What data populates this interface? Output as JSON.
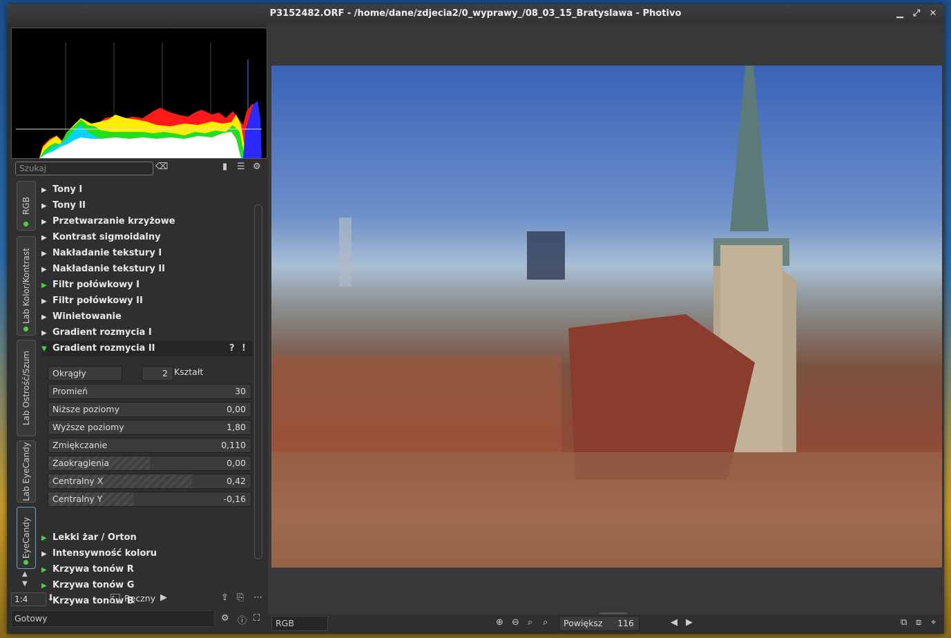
{
  "window": {
    "title": "P3152482.ORF - /home/dane/zdjecia2/0_wyprawy_/08_03_15_Bratyslawa - Photivo"
  },
  "search": {
    "placeholder": "Szukaj"
  },
  "tabs": [
    {
      "label": "RGB"
    },
    {
      "label": "Lab Kolor/Kontrast"
    },
    {
      "label": "Lab Ostrość/Szum"
    },
    {
      "label": "Lab EyeCandy"
    },
    {
      "label": "EyeCandy"
    }
  ],
  "tree": {
    "items_before": [
      {
        "label": "Tony I",
        "active": false
      },
      {
        "label": "Tony II",
        "active": false
      },
      {
        "label": "Przetwarzanie krzyżowe",
        "active": false
      },
      {
        "label": "Kontrast sigmoidalny",
        "active": false
      },
      {
        "label": "Nakładanie tekstury I",
        "active": false
      },
      {
        "label": "Nakładanie tekstury II",
        "active": false
      },
      {
        "label": "Filtr połówkowy I",
        "active": true
      },
      {
        "label": "Filtr połówkowy II",
        "active": false
      },
      {
        "label": "Winietowanie",
        "active": false
      },
      {
        "label": "Gradient rozmycia I",
        "active": false
      }
    ],
    "open_item": {
      "label": "Gradient rozmycia II"
    },
    "controls": {
      "mode": "Okrągły",
      "shape_value": "2",
      "shape_label": "Kształt",
      "sliders": [
        {
          "name": "Promień",
          "value": "30",
          "fill": 0
        },
        {
          "name": "Niższe poziomy",
          "value": "0,00",
          "fill": 0
        },
        {
          "name": "Wyższe poziomy",
          "value": "1,80",
          "fill": 0
        },
        {
          "name": "Zmiękczanie",
          "value": "0,110",
          "fill": 0
        },
        {
          "name": "Zaokrąglenia",
          "value": "0,00",
          "fill": 0.5
        },
        {
          "name": "Centralny X",
          "value": "0,42",
          "fill": 0.71
        },
        {
          "name": "Centralny Y",
          "value": "-0,16",
          "fill": 0.42
        }
      ]
    },
    "items_after": [
      {
        "label": "Lekki żar / Orton",
        "active": true
      },
      {
        "label": "Intensywność koloru",
        "active": false
      },
      {
        "label": "Krzywa tonów R",
        "active": true
      },
      {
        "label": "Krzywa tonów G",
        "active": true
      },
      {
        "label": "Krzywa tonów B",
        "active": false
      }
    ]
  },
  "bottom_left": {
    "zoom": "1:4",
    "manual_label": "Ręczny",
    "status": "Gotowy"
  },
  "bottom_bar": {
    "channel": "RGB",
    "zoom_label": "Powiększ",
    "zoom_value": "116"
  }
}
